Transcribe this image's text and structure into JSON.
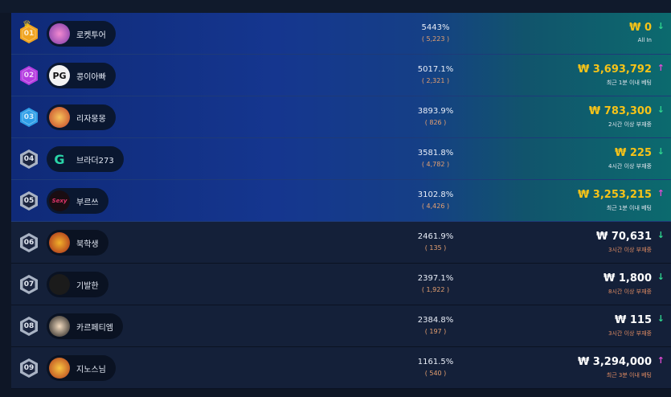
{
  "colors": {
    "gold": "#f6c318",
    "white": "#ffffff",
    "arrow_down": "#2fd58f",
    "arrow_up": "#e04bd4",
    "rank1": "#f0a31e",
    "rank2": "#b43ce0",
    "rank3": "#2f9ee8",
    "rank_other": "#a9b3c4"
  },
  "leaderboard": {
    "rows": [
      {
        "rank": "01",
        "rank_color": "#f0a31e",
        "crown": "♛",
        "avatar_icon": "rocket-tour-game-icon",
        "name": "로켓투어",
        "percent": "5443%",
        "count": "( 5,223 )",
        "amount": "₩ 0",
        "sub": "All In",
        "trend": "down",
        "trend_glyph": "↓",
        "tier": "top"
      },
      {
        "rank": "02",
        "rank_color": "#b43ce0",
        "avatar_icon": "pg-soft-logo-icon",
        "avatar_text": "PG",
        "name": "콩이아빠",
        "percent": "5017.1%",
        "count": "( 2,321 )",
        "amount": "₩ 3,693,792",
        "sub": "최근 1분 이내 베팅",
        "trend": "up",
        "trend_glyph": "↑",
        "tier": "top"
      },
      {
        "rank": "03",
        "rank_color": "#2f9ee8",
        "avatar_icon": "monkey-game-icon",
        "name": "리자몽몽",
        "percent": "3893.9%",
        "count": "( 826 )",
        "amount": "₩ 783,300",
        "sub": "2시간 이상 부재중",
        "trend": "down",
        "trend_glyph": "↓",
        "tier": "top"
      },
      {
        "rank": "04",
        "rank_color": "#a9b3c4",
        "avatar_icon": "g-logo-icon",
        "avatar_text": "G",
        "name": "브라더273",
        "percent": "3581.8%",
        "count": "( 4,782 )",
        "amount": "₩ 225",
        "sub": "4시간 이상 부재중",
        "trend": "down",
        "trend_glyph": "↓",
        "tier": "top"
      },
      {
        "rank": "05",
        "rank_color": "#a9b3c4",
        "avatar_icon": "sexy-logo-icon",
        "avatar_text": "Sexy",
        "name": "부르쓰",
        "percent": "3102.8%",
        "count": "( 4,426 )",
        "amount": "₩ 3,253,215",
        "sub": "최근 1분 이내 베팅",
        "trend": "up",
        "trend_glyph": "↑",
        "tier": "top"
      },
      {
        "rank": "06",
        "rank_color": "#a9b3c4",
        "avatar_icon": "egypt-game-icon",
        "name": "북학생",
        "percent": "2461.9%",
        "count": "( 135 )",
        "amount": "₩ 70,631",
        "sub": "3시간 이상 부재중",
        "trend": "down",
        "trend_glyph": "↓",
        "tier": "rest"
      },
      {
        "rank": "07",
        "rank_color": "#a9b3c4",
        "avatar_icon": "silhouette-game-icon",
        "name": "기발한",
        "percent": "2397.1%",
        "count": "( 1,922 )",
        "amount": "₩ 1,800",
        "sub": "8시간 이상 부재중",
        "trend": "down",
        "trend_glyph": "↓",
        "tier": "rest"
      },
      {
        "rank": "08",
        "rank_color": "#a9b3c4",
        "avatar_icon": "character-game-icon",
        "name": "카르페티엠",
        "percent": "2384.8%",
        "count": "( 197 )",
        "amount": "₩ 115",
        "sub": "3시간 이상 부재중",
        "trend": "down",
        "trend_glyph": "↓",
        "tier": "rest"
      },
      {
        "rank": "09",
        "rank_color": "#a9b3c4",
        "avatar_icon": "monkey-king-game-icon",
        "name": "지노스님",
        "percent": "1161.5%",
        "count": "( 540 )",
        "amount": "₩ 3,294,000",
        "sub": "최근 3분 이내 베팅",
        "trend": "up",
        "trend_glyph": "↑",
        "tier": "rest"
      }
    ]
  }
}
